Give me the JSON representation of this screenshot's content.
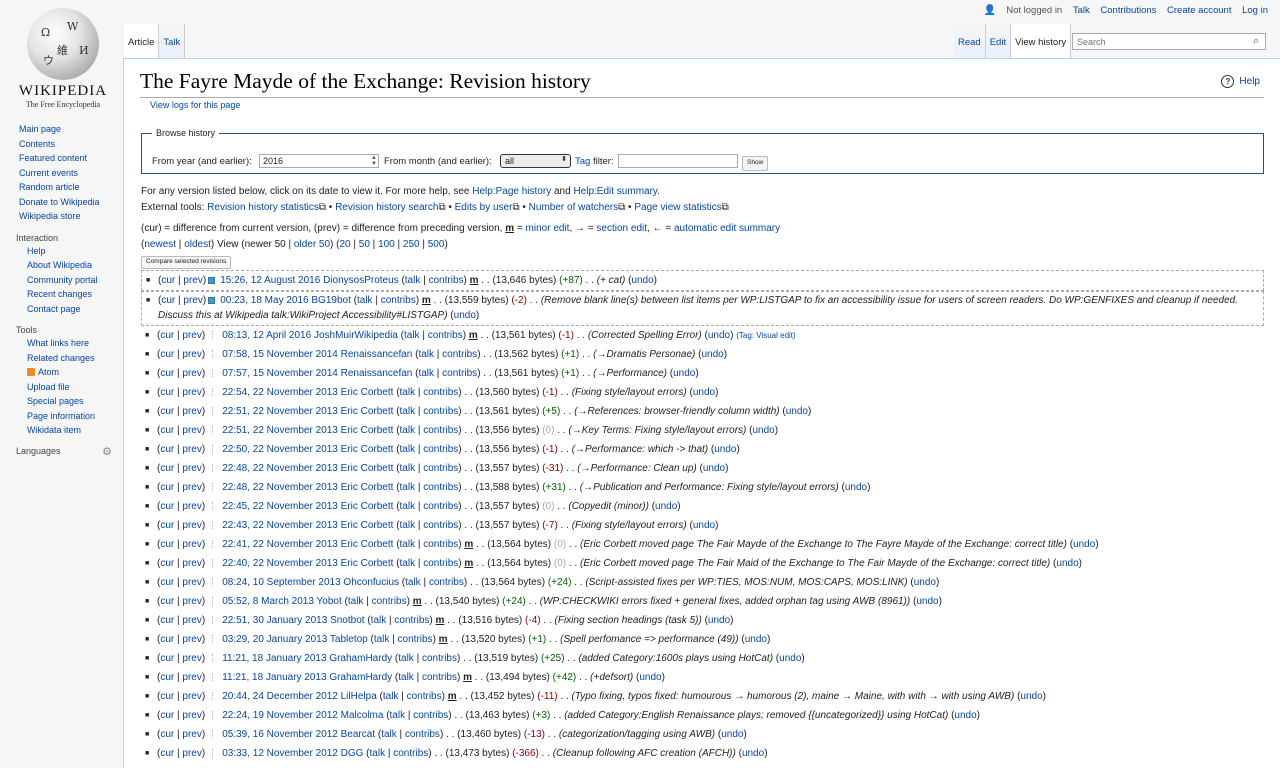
{
  "logo": {
    "wordmark": "Wikipedia",
    "tagline": "The Free Encyclopedia"
  },
  "personal": {
    "not_logged": "Not logged in",
    "talk": "Talk",
    "contribs": "Contributions",
    "create": "Create account",
    "login": "Log in"
  },
  "tabs": {
    "article": "Article",
    "talk": "Talk",
    "read": "Read",
    "edit": "Edit",
    "history": "View history"
  },
  "search": {
    "placeholder": "Search"
  },
  "sidebar": {
    "main": [
      "Main page",
      "Contents",
      "Featured content",
      "Current events",
      "Random article",
      "Donate to Wikipedia",
      "Wikipedia store"
    ],
    "interaction_h": "Interaction",
    "interaction": [
      "Help",
      "About Wikipedia",
      "Community portal",
      "Recent changes",
      "Contact page"
    ],
    "tools_h": "Tools",
    "tools": [
      "What links here",
      "Related changes",
      "Atom",
      "Upload file",
      "Special pages",
      "Page information",
      "Wikidata item"
    ],
    "languages": "Languages"
  },
  "page": {
    "title": "The Fayre Mayde of the Exchange: Revision history",
    "help": "Help",
    "view_logs": "View logs for this page"
  },
  "browse": {
    "legend": "Browse history",
    "year_label": "From year (and earlier):",
    "year_value": "2016",
    "month_label": "From month (and earlier):",
    "month_value": "all",
    "tag_link": "Tag",
    "tag_label": " filter:",
    "show": "Show"
  },
  "info": {
    "line1_pre": "For any version listed below, click on its date to view it. For more help, see ",
    "link1": "Help:Page history",
    "and": " and ",
    "link2": "Help:Edit summary",
    ".": ".",
    "ext_label": "External tools:",
    "ext": [
      "Revision history statistics",
      "Revision history search",
      "Edits by user",
      "Number of watchers",
      "Page view statistics"
    ]
  },
  "legend_text": {
    "a": "(cur) = difference from current version, (prev) = difference from preceding version, ",
    "m": "m",
    "b": " = ",
    "minor": "minor edit",
    ", ": ", ",
    "arrow": "→ = ",
    "section": "section edit",
    "c": ", ← = ",
    "auto": "automatic edit summary"
  },
  "nav": {
    "newest": "newest",
    "oldest": "oldest",
    "view": " View (newer 50 | ",
    "older": "older 50",
    ") (": ") (",
    "n20": "20",
    "n50": "50",
    "n100": "100",
    "n250": "250",
    "n500": "500"
  },
  "compare_btn": "Compare selected revisions",
  "revisions": [
    {
      "date": "15:26, 12 August 2016",
      "user": "DionysosProteus",
      "minor": true,
      "bytes": "(13,646 bytes)",
      "diff": "(+87)",
      "sign": "pos",
      "summary": "(+ cat)",
      "summary_italic": true,
      "cb": "on1"
    },
    {
      "date": "00:23, 18 May 2016",
      "user": "BG19bot",
      "minor": true,
      "bytes": "(13,559 bytes)",
      "diff": "(-2)",
      "sign": "neg",
      "summary": "(Remove blank line(s) between list items per WP:LISTGAP to fix an accessibility issue for users of screen readers. Do WP:GENFIXES and cleanup if needed. Discuss this at Wikipedia talk:WikiProject Accessibility#LISTGAP)",
      "summary_italic": true,
      "cb": "on2"
    },
    {
      "date": "08:13, 12 April 2016",
      "user": "JoshMuirWikipedia",
      "minor": true,
      "bytes": "(13,561 bytes)",
      "diff": "(-1)",
      "sign": "neg",
      "summary": "(Corrected Spelling Error)",
      "tag": "(Tag: Visual edit)"
    },
    {
      "date": "07:58, 15 November 2014",
      "user": "Renaissancefan",
      "minor": false,
      "bytes": "(13,562 bytes)",
      "diff": "(+1)",
      "sign": "pos",
      "summary": "(→Dramatis Personae)"
    },
    {
      "date": "07:57, 15 November 2014",
      "user": "Renaissancefan",
      "minor": false,
      "bytes": "(13,561 bytes)",
      "diff": "(+1)",
      "sign": "pos",
      "summary": "(→Performance)"
    },
    {
      "date": "22:54, 22 November 2013",
      "user": "Eric Corbett",
      "minor": false,
      "bytes": "(13,560 bytes)",
      "diff": "(-1)",
      "sign": "neg",
      "summary": "(Fixing style/layout errors)"
    },
    {
      "date": "22:51, 22 November 2013",
      "user": "Eric Corbett",
      "minor": false,
      "bytes": "(13,561 bytes)",
      "diff": "(+5)",
      "sign": "pos",
      "summary": "(→References:  browser-friendly column width)"
    },
    {
      "date": "22:51, 22 November 2013",
      "user": "Eric Corbett",
      "minor": false,
      "bytes": "(13,556 bytes)",
      "diff": "(0)",
      "sign": "zero",
      "summary": "(→Key Terms:  Fixing style/layout errors)"
    },
    {
      "date": "22:50, 22 November 2013",
      "user": "Eric Corbett",
      "minor": false,
      "bytes": "(13,556 bytes)",
      "diff": "(-1)",
      "sign": "neg",
      "summary": "(→Performance:  which -> that)"
    },
    {
      "date": "22:48, 22 November 2013",
      "user": "Eric Corbett",
      "minor": false,
      "bytes": "(13,557 bytes)",
      "diff": "(-31)",
      "sign": "neg",
      "summary": "(→Performance:  Clean up)"
    },
    {
      "date": "22:48, 22 November 2013",
      "user": "Eric Corbett",
      "minor": false,
      "bytes": "(13,588 bytes)",
      "diff": "(+31)",
      "sign": "pos",
      "summary": "(→Publication and Performance:  Fixing style/layout errors)"
    },
    {
      "date": "22:45, 22 November 2013",
      "user": "Eric Corbett",
      "minor": false,
      "bytes": "(13,557 bytes)",
      "diff": "(0)",
      "sign": "zero",
      "summary": "(Copyedit (minor))"
    },
    {
      "date": "22:43, 22 November 2013",
      "user": "Eric Corbett",
      "minor": false,
      "bytes": "(13,557 bytes)",
      "diff": "(-7)",
      "sign": "neg",
      "summary": "(Fixing style/layout errors)"
    },
    {
      "date": "22:41, 22 November 2013",
      "user": "Eric Corbett",
      "minor": true,
      "bytes": "(13,564 bytes)",
      "diff": "(0)",
      "sign": "zero",
      "summary": "(Eric Corbett moved page The Fair Mayde of the Exchange to The Fayre Mayde of the Exchange: correct title)"
    },
    {
      "date": "22:40, 22 November 2013",
      "user": "Eric Corbett",
      "minor": true,
      "bytes": "(13,564 bytes)",
      "diff": "(0)",
      "sign": "zero",
      "summary": "(Eric Corbett moved page The Fair Maid of the Exchange to The Fair Mayde of the Exchange: correct title)"
    },
    {
      "date": "08:24, 10 September 2013",
      "user": "Ohconfucius",
      "minor": false,
      "bytes": "(13,564 bytes)",
      "diff": "(+24)",
      "sign": "pos",
      "summary": "(Script-assisted fixes per WP:TIES, MOS:NUM, MOS:CAPS, MOS:LINK)"
    },
    {
      "date": "05:52, 8 March 2013",
      "user": "Yobot",
      "minor": true,
      "bytes": "(13,540 bytes)",
      "diff": "(+24)",
      "sign": "pos",
      "summary": "(WP:CHECKWIKI errors fixed + general fixes, added orphan tag using AWB (8961))"
    },
    {
      "date": "22:51, 30 January 2013",
      "user": "Snotbot",
      "minor": true,
      "bytes": "(13,516 bytes)",
      "diff": "(-4)",
      "sign": "neg",
      "summary": "(Fixing section headings (task 5))"
    },
    {
      "date": "03:29, 20 January 2013",
      "user": "Tabletop",
      "minor": true,
      "bytes": "(13,520 bytes)",
      "diff": "(+1)",
      "sign": "pos",
      "summary": "(Spell perfomance => performance (49))"
    },
    {
      "date": "11:21, 18 January 2013",
      "user": "GrahamHardy",
      "minor": false,
      "bytes": "(13,519 bytes)",
      "diff": "(+25)",
      "sign": "pos",
      "summary": "(added Category:1600s plays using HotCat)"
    },
    {
      "date": "11:21, 18 January 2013",
      "user": "GrahamHardy",
      "minor": true,
      "bytes": "(13,494 bytes)",
      "diff": "(+42)",
      "sign": "pos",
      "summary": "(+defsort)"
    },
    {
      "date": "20:44, 24 December 2012",
      "user": "LilHelpa",
      "minor": true,
      "bytes": "(13,452 bytes)",
      "diff": "(-11)",
      "sign": "neg",
      "summary": "(Typo fixing, typos fixed: humourous → humorous (2), maine → Maine, with with → with using AWB)"
    },
    {
      "date": "22:24, 19 November 2012",
      "user": "Malcolma",
      "minor": false,
      "bytes": "(13,463 bytes)",
      "diff": "(+3)",
      "sign": "pos",
      "summary": "(added Category:English Renaissance plays; removed {{uncategorized}} using HotCat)"
    },
    {
      "date": "05:39, 16 November 2012",
      "user": "Bearcat",
      "minor": false,
      "bytes": "(13,460 bytes)",
      "diff": "(-13)",
      "sign": "neg",
      "summary": "(categorization/tagging using AWB)"
    },
    {
      "date": "03:33, 12 November 2012",
      "user": "DGG",
      "minor": false,
      "bytes": "(13,473 bytes)",
      "diff": "(-366)",
      "sign": "neg",
      "summary": "(Cleanup following AFC creation (AFCH))"
    }
  ],
  "row_strings": {
    "cur": "cur",
    "prev": "prev",
    "talk": "talk",
    "contribs": "contribs",
    "undo": "undo",
    "m": "m",
    "sep": " | ",
    "dots": " . . "
  }
}
